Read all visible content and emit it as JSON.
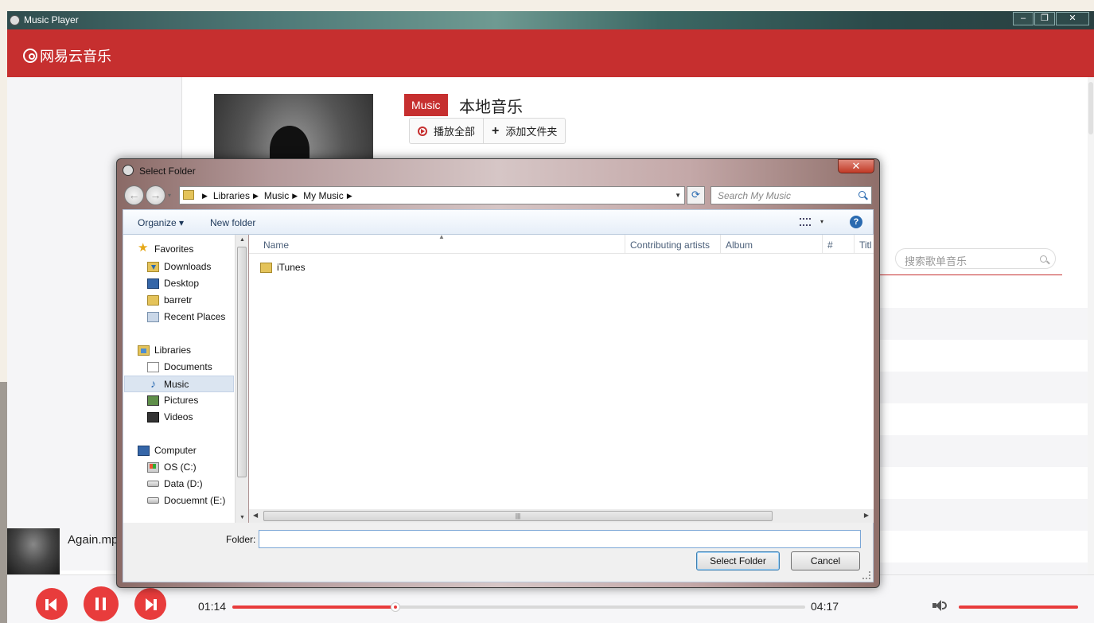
{
  "window": {
    "title": "Music Player",
    "min": "–",
    "max": "❐",
    "close": "✕"
  },
  "header": {
    "logo_text": "网易云音乐"
  },
  "content": {
    "tag": "Music",
    "title": "本地音乐",
    "play_all": "播放全部",
    "add_folder": "添加文件夹",
    "search_placeholder": "搜索歌单音乐"
  },
  "now_playing": {
    "track": "Again.mp"
  },
  "player": {
    "current_time": "01:14",
    "total_time": "04:17",
    "progress_fraction": 0.285,
    "volume_fraction": 1.0
  },
  "dialog": {
    "title": "Select Folder",
    "close": "✕",
    "back": "←",
    "forward": "→",
    "breadcrumb": [
      "Libraries",
      "Music",
      "My Music"
    ],
    "breadcrumb_sep": "▶",
    "search_placeholder": "Search My Music",
    "refresh": "⟳",
    "toolbar": {
      "organize": "Organize ▾",
      "new_folder": "New folder",
      "view_dropdown": "▾",
      "help": "?"
    },
    "nav": {
      "favorites": "Favorites",
      "downloads": "Downloads",
      "desktop": "Desktop",
      "user": "barretr",
      "recent": "Recent Places",
      "libraries": "Libraries",
      "documents": "Documents",
      "music": "Music",
      "pictures": "Pictures",
      "videos": "Videos",
      "computer": "Computer",
      "os_drive": "OS (C:)",
      "data_drive": "Data (D:)",
      "doc_drive": "Docuemnt (E:)"
    },
    "columns": [
      "Name",
      "Contributing artists",
      "Album",
      "#",
      "Titl"
    ],
    "files": [
      {
        "name": "iTunes",
        "type": "folder"
      }
    ],
    "folder_label": "Folder:",
    "folder_value": "",
    "select_button": "Select Folder",
    "cancel_button": "Cancel"
  },
  "colors": {
    "brand": "#c62f2f",
    "accent": "#e83c3c"
  }
}
